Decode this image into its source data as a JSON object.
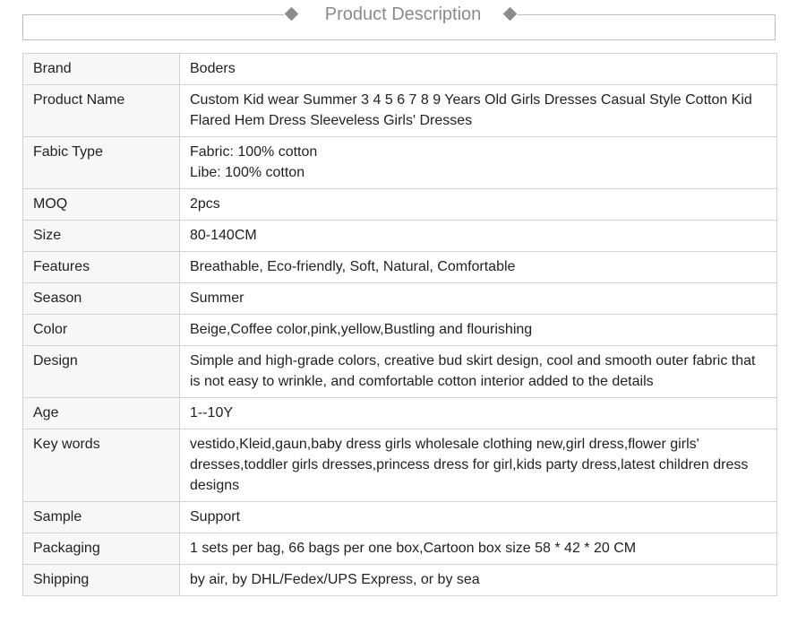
{
  "section": {
    "title": "Product Description"
  },
  "specs": [
    {
      "label": "Brand",
      "value": "Boders"
    },
    {
      "label": "Product Name",
      "value": "Custom Kid wear Summer 3 4 5 6 7 8 9 Years Old Girls Dresses Casual Style Cotton Kid Flared Hem Dress Sleeveless Girls' Dresses"
    },
    {
      "label": "Fabic Type",
      "value": "Fabric: 100% cotton\nLibe: 100% cotton"
    },
    {
      "label": "MOQ",
      "value": "2pcs"
    },
    {
      "label": "Size",
      "value": "80-140CM"
    },
    {
      "label": "Features",
      "value": "Breathable, Eco-friendly, Soft, Natural, Comfortable"
    },
    {
      "label": "Season",
      "value": "Summer"
    },
    {
      "label": "Color",
      "value": "Beige,Coffee color,pink,yellow,Bustling and flourishing"
    },
    {
      "label": "Design",
      "value": "Simple and high-grade colors, creative bud skirt design, cool and smooth outer fabric that is not easy to wrinkle, and comfortable cotton interior added to the details"
    },
    {
      "label": "Age",
      "value": "1--10Y"
    },
    {
      "label": "Key words",
      "value": "vestido,Kleid,gaun,baby dress girls wholesale clothing new,girl dress,flower girls' dresses,toddler girls dresses,princess dress for girl,kids party dress,latest children dress designs"
    },
    {
      "label": "Sample",
      "value": "Support"
    },
    {
      "label": "Packaging",
      "value": "1 sets per bag, 66 bags per one box,Cartoon box size 58 * 42 * 20 CM"
    },
    {
      "label": "Shipping",
      "value": "by air, by DHL/Fedex/UPS Express, or by sea"
    }
  ]
}
